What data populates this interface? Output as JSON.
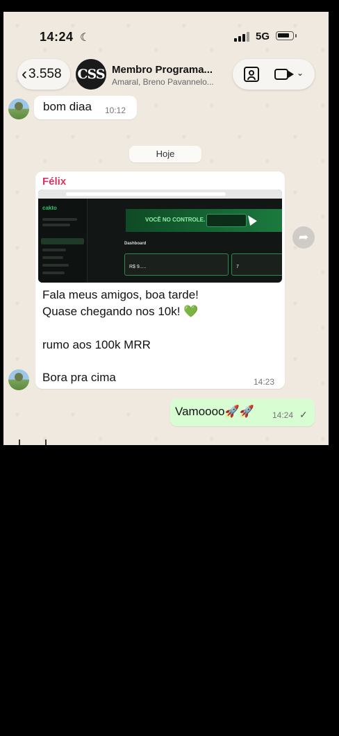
{
  "status_bar": {
    "time": "14:24",
    "network": "5G"
  },
  "header": {
    "back_count": "3.558",
    "avatar_text": "CSS",
    "title": "Membro Programa...",
    "subtitle": "Amaral, Breno Pavannelo..."
  },
  "messages": {
    "first": {
      "text": "bom diaa",
      "time": "10:12"
    },
    "day_label": "Hoje",
    "felix": {
      "sender": "Félix",
      "lines": [
        "Fala meus amigos, boa tarde!",
        "Quase chegando nos 10k! 💚",
        "rumo aos 100k MRR",
        "Bora pra cima"
      ],
      "time": "14:23",
      "screenshot": {
        "logo": "cakto",
        "banner": "VOCÊ NO CONTROLE.",
        "dashboard": "Dashboard",
        "value": "R$ 9.....",
        "value2": "7"
      }
    },
    "outgoing": {
      "text": "Vamoooo🚀🚀",
      "time": "14:24",
      "check": "✓"
    }
  }
}
